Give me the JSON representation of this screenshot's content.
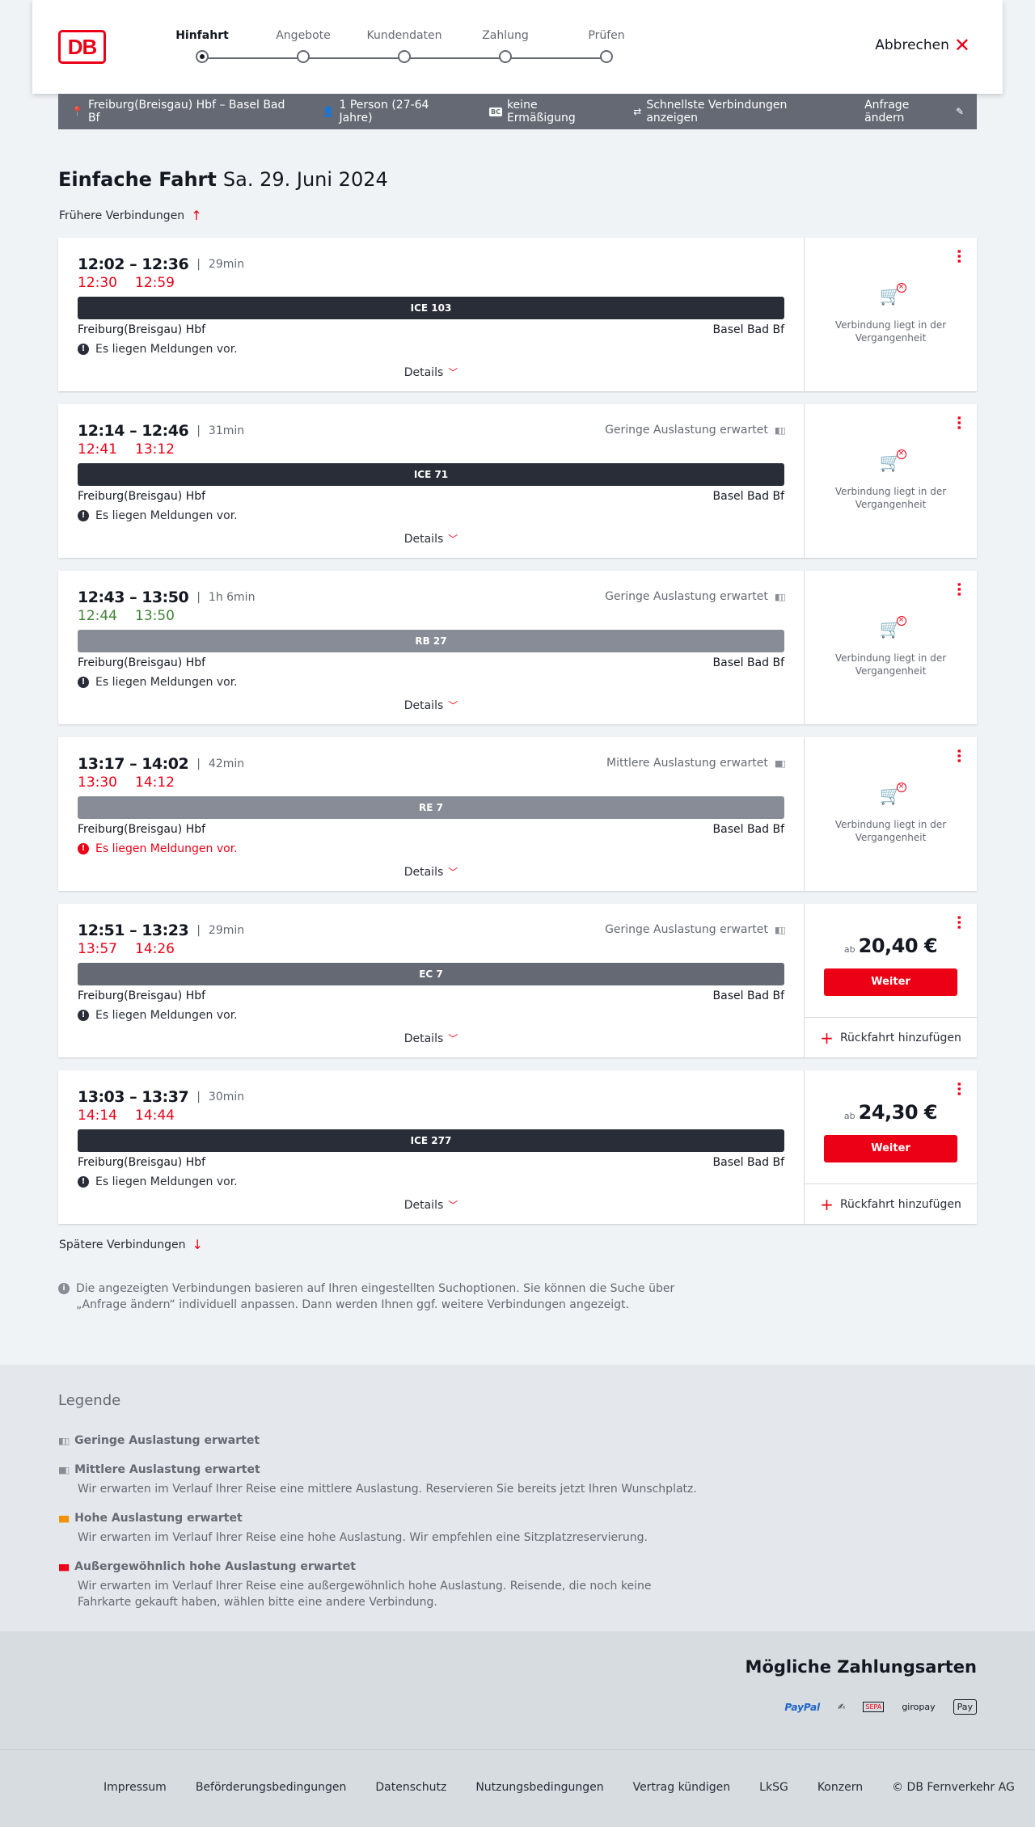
{
  "steps": [
    "Hinfahrt",
    "Angebote",
    "Kundendaten",
    "Zahlung",
    "Prüfen"
  ],
  "logo_text": "DB",
  "cancel_label": "Abbrechen",
  "search": {
    "route": "Freiburg(Breisgau) Hbf – Basel Bad Bf",
    "persons": "1 Person (27-64 Jahre)",
    "bc_badge": "BC",
    "discount": "keine Ermäßigung",
    "fastest": "Schnellste Verbindungen anzeigen",
    "change": "Anfrage ändern"
  },
  "title": {
    "type": "Einfache Fahrt",
    "date": "Sa. 29. Juni 2024"
  },
  "earlier_label": "Frühere Verbindungen",
  "later_label": "Spätere Verbindungen",
  "common": {
    "from": "Freiburg(Breisgau) Hbf",
    "to": "Basel Bad Bf",
    "details": "Details",
    "past_text": "Verbindung liegt in der Vergangenheit",
    "price_prefix": "ab",
    "next_button": "Weiter",
    "return_label": "Rückfahrt hinzufügen"
  },
  "connections": [
    {
      "times": "12:02 – 12:36",
      "duration": "29min",
      "rt_dep": "12:30",
      "rt_arr": "12:59",
      "rt_color": "late",
      "occupancy": "",
      "train": "ICE 103",
      "train_style": "dark",
      "message": "Es liegen Meldungen vor.",
      "message_warn": false,
      "price": "",
      "status": "past"
    },
    {
      "times": "12:14 – 12:46",
      "duration": "31min",
      "rt_dep": "12:41",
      "rt_arr": "13:12",
      "rt_color": "late",
      "occupancy": "Geringe Auslastung erwartet",
      "train": "ICE 71",
      "train_style": "dark",
      "message": "Es liegen Meldungen vor.",
      "message_warn": false,
      "price": "",
      "status": "past"
    },
    {
      "times": "12:43 – 13:50",
      "duration": "1h 6min",
      "rt_dep": "12:44",
      "rt_arr": "13:50",
      "rt_color": "ok",
      "occupancy": "Geringe Auslastung erwartet",
      "train": "RB 27",
      "train_style": "grey",
      "message": "Es liegen Meldungen vor.",
      "message_warn": false,
      "price": "",
      "status": "past"
    },
    {
      "times": "13:17 – 14:02",
      "duration": "42min",
      "rt_dep": "13:30",
      "rt_arr": "14:12",
      "rt_color": "late",
      "occupancy": "Mittlere Auslastung erwartet",
      "train": "RE 7",
      "train_style": "grey",
      "message": "Es liegen Meldungen vor.",
      "message_warn": true,
      "price": "",
      "status": "past"
    },
    {
      "times": "12:51 – 13:23",
      "duration": "29min",
      "rt_dep": "13:57",
      "rt_arr": "14:26",
      "rt_color": "late",
      "occupancy": "Geringe Auslastung erwartet",
      "train": "EC 7",
      "train_style": "mid",
      "message": "Es liegen Meldungen vor.",
      "message_warn": false,
      "price": "20,40 €",
      "status": "bookable"
    },
    {
      "times": "13:03 – 13:37",
      "duration": "30min",
      "rt_dep": "14:14",
      "rt_arr": "14:44",
      "rt_color": "late",
      "occupancy": "",
      "train": "ICE 277",
      "train_style": "dark",
      "message": "Es liegen Meldungen vor.",
      "message_warn": false,
      "price": "24,30 €",
      "status": "bookable"
    }
  ],
  "info_text": "Die angezeigten Verbindungen basieren auf Ihren eingestellten Suchoptionen. Sie können die Suche über „Anfrage ändern“ individuell anpassen. Dann werden Ihnen ggf. weitere Verbindungen angezeigt.",
  "legend": {
    "title": "Legende",
    "items": [
      {
        "label": "Geringe Auslastung erwartet",
        "desc": "",
        "level": "low"
      },
      {
        "label": "Mittlere Auslastung erwartet",
        "desc": "Wir erwarten im Verlauf Ihrer Reise eine mittlere Auslastung. Reservieren Sie bereits jetzt Ihren Wunschplatz.",
        "level": "mid"
      },
      {
        "label": "Hohe Auslastung erwartet",
        "desc": "Wir erwarten im Verlauf Ihrer Reise eine hohe Auslastung. Wir empfehlen eine Sitzplatzreservierung.",
        "level": "high"
      },
      {
        "label": "Außergewöhnlich hohe Auslastung erwartet",
        "desc": "Wir erwarten im Verlauf Ihrer Reise eine außergewöhnlich hohe Auslastung. Reisende, die noch keine Fahrkarte gekauft haben, wählen bitte eine andere Verbindung.",
        "level": "extreme"
      }
    ]
  },
  "payments": {
    "title": "Mögliche Zahlungsarten",
    "methods": [
      "PayPal",
      "SEPA",
      "giropay",
      "Pay"
    ]
  },
  "footer": [
    "Impressum",
    "Beförderungsbedingungen",
    "Datenschutz",
    "Nutzungsbedingungen",
    "Vertrag kündigen",
    "LkSG",
    "Konzern",
    "© DB Fernverkehr AG"
  ]
}
